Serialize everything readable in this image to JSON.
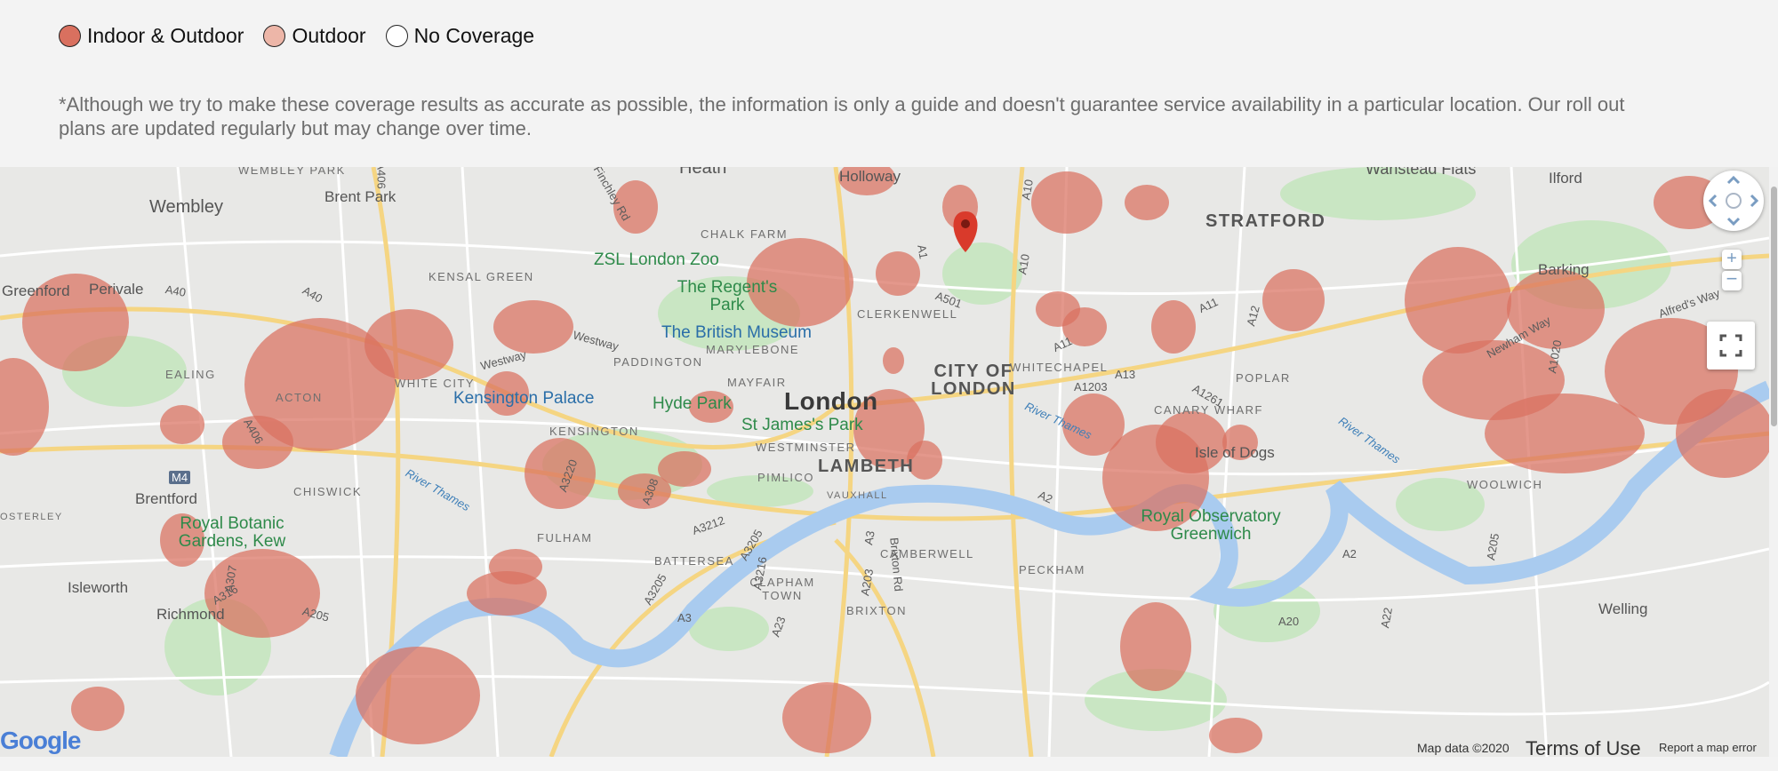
{
  "legend": {
    "items": [
      {
        "label": "Indoor & Outdoor",
        "color": "#d9705f"
      },
      {
        "label": "Outdoor",
        "color": "#edb6a8"
      },
      {
        "label": "No Coverage",
        "color": "#ffffff"
      }
    ]
  },
  "disclaimer": "*Although we try to make these coverage results as accurate as possible, the information is only a guide and doesn't guarantee service availability in a particular location. Our roll out plans are updated regularly but may change over time.",
  "map": {
    "colors": {
      "coverage": "#d9705f",
      "river": "#a9cbef",
      "park": "#c9e6c3",
      "road_major": "#f5d582",
      "marker": "#d93a2b"
    },
    "places": {
      "wembley_park": "WEMBLEY PARK",
      "heath": "Heath",
      "holloway": "Holloway",
      "wanstead_flats": "Wanstead Flats",
      "ilford": "Ilford",
      "wembley": "Wembley",
      "brent_park": "Brent Park",
      "stratford": "STRATFORD",
      "chalk_farm": "CHALK FARM",
      "zsl": "ZSL London Zoo",
      "kensal_green": "KENSAL GREEN",
      "barking": "Barking",
      "greenford": "Greenford",
      "perivale": "Perivale",
      "regents_park": "The Regent's Park",
      "british_museum": "The British Museum",
      "clerkenwell": "CLERKENWELL",
      "marylebone": "MARYLEBONE",
      "paddington": "PADDINGTON",
      "city_of_london": "CITY OF LONDON",
      "whitechapel": "WHITECHAPEL",
      "ealing": "EALING",
      "white_city": "WHITE CITY",
      "acton": "ACTON",
      "kensington_palace": "Kensington Palace",
      "mayfair": "MAYFAIR",
      "hyde_park": "Hyde Park",
      "london": "London",
      "poplar": "POPLAR",
      "canary_wharf": "CANARY WHARF",
      "st_james": "St James's Park",
      "kensington": "KENSINGTON",
      "westminster": "WESTMINSTER",
      "isle_of_dogs": "Isle of Dogs",
      "lambeth": "LAMBETH",
      "pimlico": "PIMLICO",
      "chiswick": "CHISWICK",
      "brentford": "Brentford",
      "osterley": "OSTERLEY",
      "woolwich": "WOOLWICH",
      "vauxhall": "VAUXHALL",
      "royal_botanic": "Royal Botanic\nGardens, Kew",
      "fulham": "FULHAM",
      "royal_observatory": "Royal Observatory\nGreenwich",
      "battersea": "BATTERSEA",
      "camberwell": "CAMBERWELL",
      "peckham": "PECKHAM",
      "clapham": "CLAPHAM\nTOWN",
      "isleworth": "Isleworth",
      "richmond": "Richmond",
      "brixton": "BRIXTON",
      "welling": "Welling"
    },
    "roads": {
      "a406": "A406",
      "a10": "A10",
      "a1": "A1",
      "a501": "A501",
      "a40": "A40",
      "a40b": "A40",
      "westway": "Westway",
      "a11": "A11",
      "a11b": "A11",
      "a12": "A12",
      "a13": "A13",
      "a1203": "A1203",
      "a1261": "A1261",
      "alfreds_way": "Alfred's Way",
      "newham_way": "Newham Way",
      "a1020": "A1020",
      "a406b": "A406",
      "m4": "M4",
      "a3220": "A3220",
      "a308": "A308",
      "a3212": "A3212",
      "a3205": "A3205",
      "a3216": "A3216",
      "a3205b": "A3205",
      "a3": "A3",
      "a3b": "A3",
      "a23": "A23",
      "a203": "A203",
      "brixton_rd": "Brixton Rd",
      "a2": "A2",
      "a2b": "A2",
      "a205": "A205",
      "a205b": "A205",
      "a307": "A307",
      "a316": "A316",
      "a20": "A20",
      "a22": "A22",
      "finchley_rd": "Finchley Rd"
    },
    "rivers": {
      "thames_west": "River Thames",
      "thames_central": "River Thames",
      "thames_east": "River Thames"
    },
    "controls": {
      "zoom_in": "+",
      "zoom_out": "−"
    },
    "attribution": {
      "map_data": "Map data ©2020",
      "terms": "Terms of Use",
      "report": "Report a map error",
      "google": "Google"
    }
  }
}
